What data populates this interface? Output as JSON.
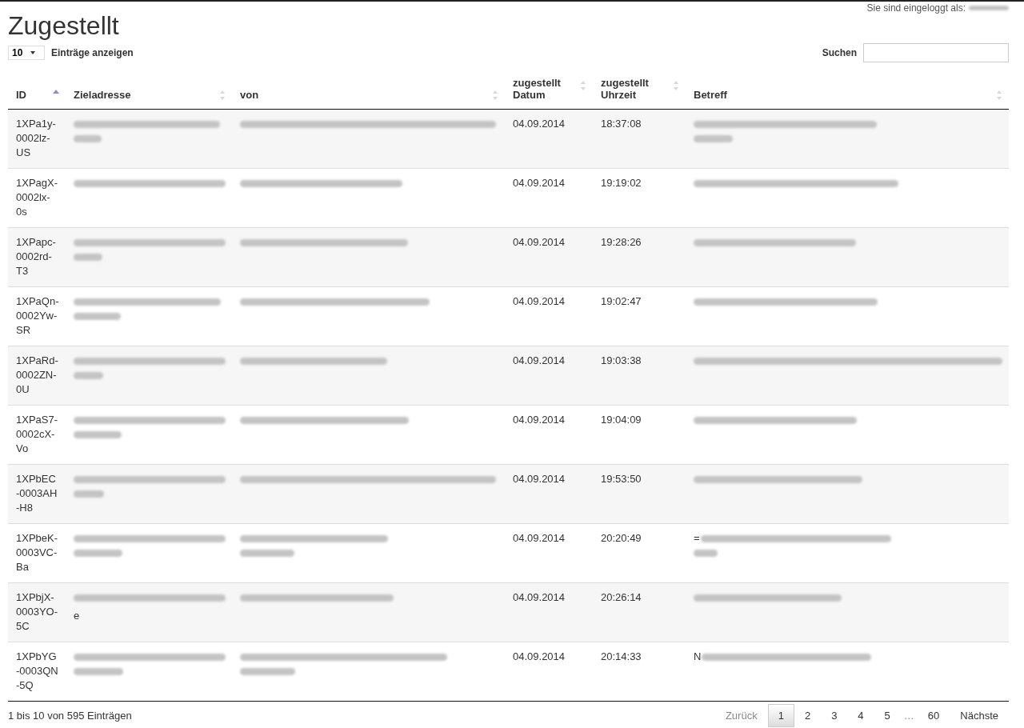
{
  "login_notice": {
    "label": "Sie sind eingeloggt als:",
    "name_redacted": true
  },
  "title": "Zugestellt",
  "length_select": {
    "value": "10",
    "label": "Einträge anzeigen"
  },
  "search": {
    "label": "Suchen"
  },
  "table": {
    "columns": [
      {
        "label": "ID",
        "sorted_ascending": true
      },
      {
        "label": "Zieladresse",
        "sorted_ascending": false
      },
      {
        "label": "von",
        "sorted_ascending": false
      },
      {
        "label": "zugestellt Datum",
        "sorted_ascending": false
      },
      {
        "label": "zugestellt Uhrzeit",
        "sorted_ascending": false
      },
      {
        "label": "Betreff",
        "sorted_ascending": false
      }
    ],
    "rows": [
      {
        "id": "1XPa1y-0002lz-US",
        "ziel": {
          "redacted": true,
          "wraps": true
        },
        "von": {
          "redacted": true,
          "wraps": false
        },
        "datum": "04.09.2014",
        "uhrzeit": "18:37:08",
        "betreff": {
          "redacted": true,
          "wraps": true
        }
      },
      {
        "id": "1XPagX-0002lx-0s",
        "ziel": {
          "redacted": true,
          "wraps": false
        },
        "von": {
          "redacted": true,
          "wraps": false
        },
        "datum": "04.09.2014",
        "uhrzeit": "19:19:02",
        "betreff": {
          "redacted": true,
          "wraps": false
        }
      },
      {
        "id": "1XPapc-0002rd-T3",
        "ziel": {
          "redacted": true,
          "wraps": true
        },
        "von": {
          "redacted": true,
          "wraps": false
        },
        "datum": "04.09.2014",
        "uhrzeit": "19:28:26",
        "betreff": {
          "redacted": true,
          "wraps": false
        }
      },
      {
        "id": "1XPaQn-0002Yw-SR",
        "ziel": {
          "redacted": true,
          "wraps": true
        },
        "von": {
          "redacted": true,
          "wraps": false
        },
        "datum": "04.09.2014",
        "uhrzeit": "19:02:47",
        "betreff": {
          "redacted": true,
          "wraps": false
        }
      },
      {
        "id": "1XPaRd-0002ZN-0U",
        "ziel": {
          "redacted": true,
          "wraps": true
        },
        "von": {
          "redacted": true,
          "wraps": false
        },
        "datum": "04.09.2014",
        "uhrzeit": "19:03:38",
        "betreff": {
          "redacted": true,
          "wraps": false
        }
      },
      {
        "id": "1XPaS7-0002cX-Vo",
        "ziel": {
          "redacted": true,
          "wraps": true
        },
        "von": {
          "redacted": true,
          "wraps": false
        },
        "datum": "04.09.2014",
        "uhrzeit": "19:04:09",
        "betreff": {
          "redacted": true,
          "wraps": false
        }
      },
      {
        "id": "1XPbEC-0003AH-H8",
        "ziel": {
          "redacted": true,
          "wraps": true
        },
        "von": {
          "redacted": true,
          "wraps": false
        },
        "datum": "04.09.2014",
        "uhrzeit": "19:53:50",
        "betreff": {
          "redacted": true,
          "wraps": false
        }
      },
      {
        "id": "1XPbeK-0003VC-Ba",
        "ziel": {
          "redacted": true,
          "wraps": true
        },
        "von": {
          "redacted": true,
          "wraps": true
        },
        "datum": "04.09.2014",
        "uhrzeit": "20:20:49",
        "betreff": {
          "text": "=",
          "redacted": true,
          "wraps": true
        }
      },
      {
        "id": "1XPbjX-0003YO-5C",
        "ziel": {
          "redacted": true,
          "wraps": false,
          "tail": "e"
        },
        "von": {
          "redacted": true,
          "wraps": false
        },
        "datum": "04.09.2014",
        "uhrzeit": "20:26:14",
        "betreff": {
          "redacted": true,
          "wraps": false
        }
      },
      {
        "id": "1XPbYG-0003QN-5Q",
        "ziel": {
          "redacted": true,
          "wraps": true
        },
        "von": {
          "redacted": true,
          "wraps": true
        },
        "datum": "04.09.2014",
        "uhrzeit": "20:14:33",
        "betreff": {
          "text": "N",
          "redacted": true,
          "wraps": false
        }
      }
    ]
  },
  "info": "1 bis 10 von 595 Einträgen",
  "pagination": {
    "previous": {
      "label": "Zurück",
      "disabled": true
    },
    "pages": [
      {
        "label": "1",
        "selected": true
      },
      {
        "label": "2",
        "selected": false
      },
      {
        "label": "3",
        "selected": false
      },
      {
        "label": "4",
        "selected": false
      },
      {
        "label": "5",
        "selected": false
      }
    ],
    "ellipsis": "…",
    "last": {
      "label": "60",
      "selected": false
    },
    "next": {
      "label": "Nächste",
      "disabled": false
    }
  }
}
